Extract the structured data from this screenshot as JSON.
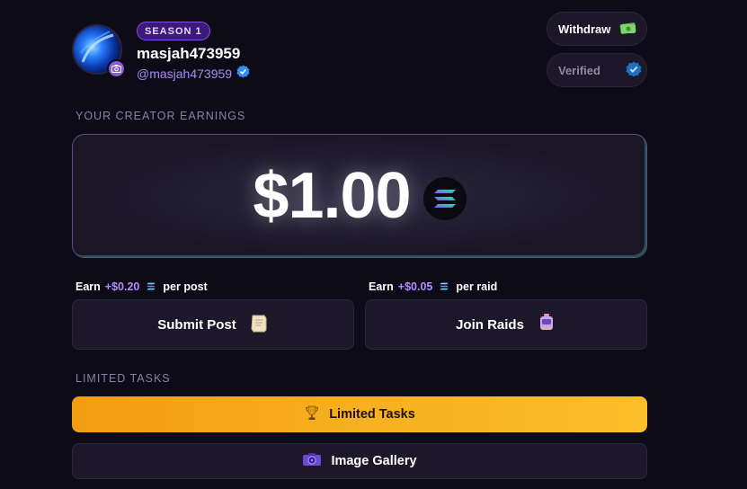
{
  "profile": {
    "season_badge": "SEASON 1",
    "username": "masjah473959",
    "handle": "@masjah473959"
  },
  "header_actions": {
    "withdraw_label": "Withdraw",
    "verified_label": "Verified"
  },
  "earnings": {
    "section_label": "YOUR CREATOR EARNINGS",
    "amount": "$1.00",
    "currency_icon": "solana-icon"
  },
  "actions": [
    {
      "earn_prefix": "Earn",
      "earn_amount": "+$0.20",
      "earn_suffix": "per post",
      "label": "Submit Post",
      "icon": "scroll-icon"
    },
    {
      "earn_prefix": "Earn",
      "earn_amount": "+$0.05",
      "earn_suffix": "per raid",
      "label": "Join Raids",
      "icon": "raid-icon"
    }
  ],
  "limited": {
    "section_label": "LIMITED TASKS",
    "limited_tasks_label": "Limited Tasks",
    "image_gallery_label": "Image Gallery"
  },
  "colors": {
    "background": "#0e0b18",
    "accent_purple": "#a98bf0",
    "card_bg": "#1c1829",
    "limited_orange": "#f8b322"
  }
}
